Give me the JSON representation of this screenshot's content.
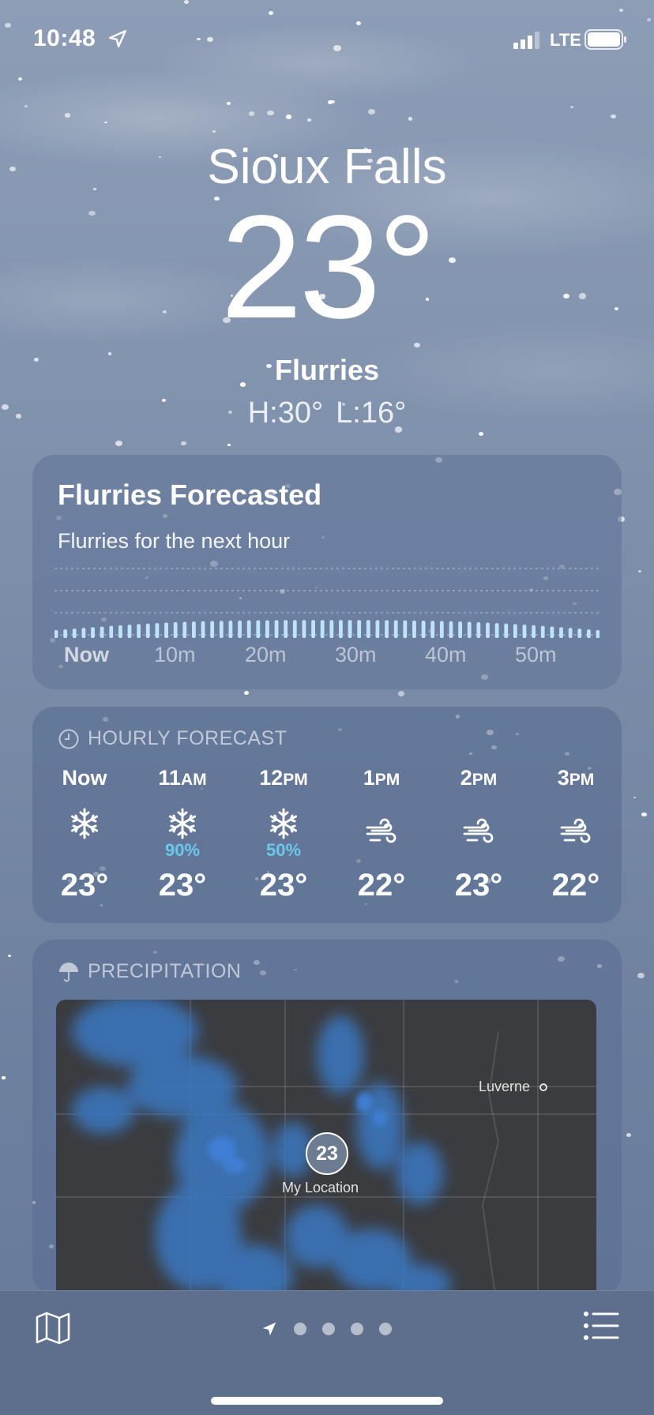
{
  "status": {
    "time": "10:48",
    "network": "LTE"
  },
  "location": {
    "city": "Sioux Falls",
    "temperature": "23°",
    "condition": "Flurries",
    "high": "H:30°",
    "low": "L:16°"
  },
  "nowcast": {
    "title": "Flurries Forecasted",
    "subtitle": "Flurries for the next hour",
    "axis_labels": [
      "Now",
      "10m",
      "20m",
      "30m",
      "40m",
      "50m"
    ]
  },
  "hourly": {
    "header": "HOURLY FORECAST",
    "items": [
      {
        "hour": "Now",
        "suffix": "",
        "icon": "snowflake-icon",
        "precip": "",
        "temp": "23°"
      },
      {
        "hour": "11",
        "suffix": "AM",
        "icon": "snowflake-icon",
        "precip": "90%",
        "temp": "23°"
      },
      {
        "hour": "12",
        "suffix": "PM",
        "icon": "snowflake-icon",
        "precip": "50%",
        "temp": "23°"
      },
      {
        "hour": "1",
        "suffix": "PM",
        "icon": "wind-icon",
        "precip": "",
        "temp": "22°"
      },
      {
        "hour": "2",
        "suffix": "PM",
        "icon": "wind-icon",
        "precip": "",
        "temp": "23°"
      },
      {
        "hour": "3",
        "suffix": "PM",
        "icon": "wind-icon",
        "precip": "",
        "temp": "22°"
      }
    ]
  },
  "precipitation": {
    "header": "PRECIPITATION",
    "map_pin_temp": "23",
    "my_location_label": "My Location",
    "town_label": "Luverne"
  },
  "colors": {
    "precip_accent": "#69c9ea",
    "radar_blue": "#3f7fd6"
  }
}
